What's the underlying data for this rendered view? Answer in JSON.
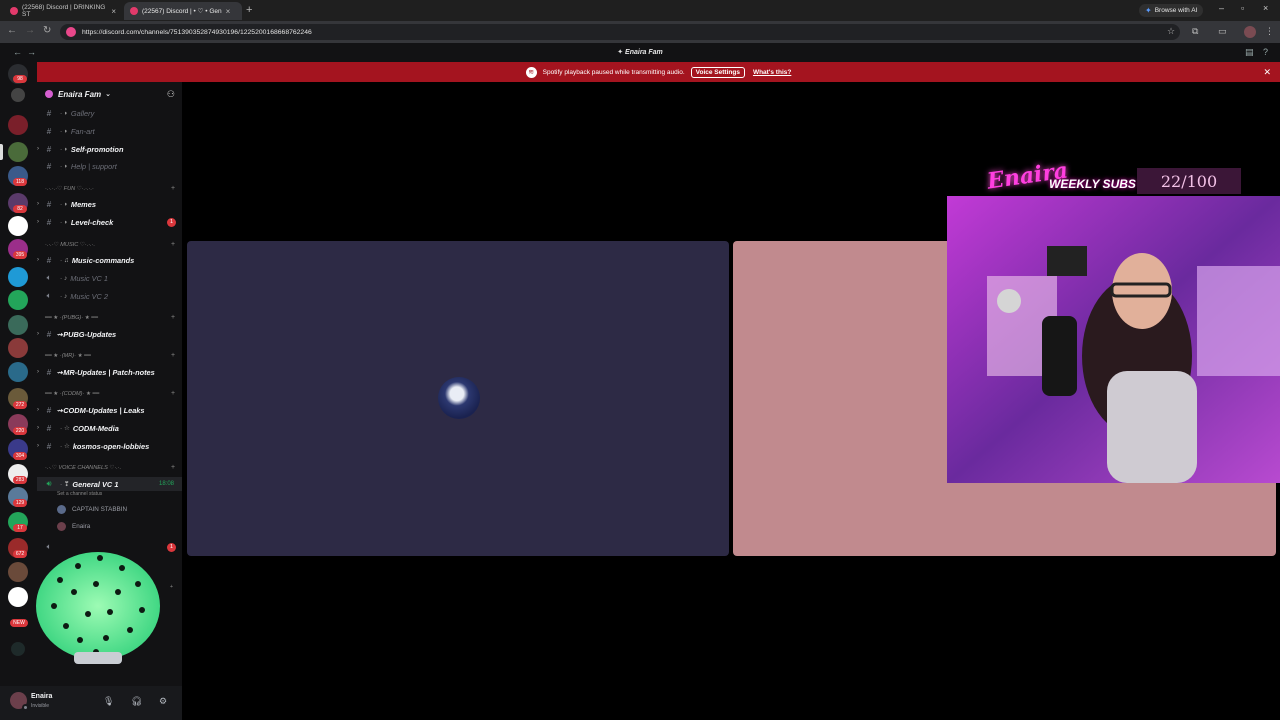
{
  "browser": {
    "tabs": [
      {
        "title": "(22568) Discord | DRINKING ST"
      },
      {
        "title": "(22567) Discord | • ♡ • Gen"
      }
    ],
    "new_tab": "+",
    "browse_ai": "Browse with AI",
    "url": "https://discord.com/channels/751390352874930196/1225200168668762246"
  },
  "discord": {
    "window_title": "Enaira Fam",
    "notice": {
      "message": "Spotify playback paused while transmitting audio.",
      "voice_settings": "Voice Settings",
      "whats_this": "What's this?"
    },
    "rail_badges": [
      "98",
      "118",
      "82",
      "395",
      "272",
      "220",
      "304",
      "283",
      "129",
      "17",
      "672",
      "NEW"
    ],
    "server": {
      "name": "Enaira Fam"
    },
    "channels": [
      {
        "label": "Gallery"
      },
      {
        "label": "Fan-art"
      },
      {
        "label": "Self-promotion"
      },
      {
        "label": "Help | support"
      },
      {
        "label": "Memes"
      },
      {
        "label": "Level-check",
        "unread": "1"
      },
      {
        "label": "Music-commands"
      },
      {
        "label": "Music VC 1"
      },
      {
        "label": "Music VC 2"
      },
      {
        "label": "⇝PUBG-Updates"
      },
      {
        "label": "⇝MR-Updates | Patch-notes"
      },
      {
        "label": "⇝CODM-Updates | Leaks"
      },
      {
        "label": "CODM-Media"
      },
      {
        "label": "kosmos-open-lobbies"
      },
      {
        "label": "General VC 1",
        "timer": "18:08"
      }
    ],
    "categories": [
      {
        "label": "·.·.·.·♡ FUN ♡·.·.·.·"
      },
      {
        "label": "·.·.·♡ MUSIC ♡·.·.·."
      },
      {
        "label": "━━ ★ ·(PUBG)· ★ ━━"
      },
      {
        "label": "━━ ★ ·(MR)· ★ ━━"
      },
      {
        "label": "━━ ★ ·(CODM)· ★ ━━"
      },
      {
        "label": "·.·.♡ VOICE CHANNELS ♡·.·."
      }
    ],
    "set_status": "Set a channel status",
    "voice_users": [
      {
        "name": "CAPTAIN STABBIN"
      },
      {
        "name": "Enaira"
      }
    ],
    "extra_unread": "1",
    "user": {
      "name": "Enaira",
      "status": "Invisible"
    }
  },
  "stream_overlay": {
    "brand": "Enaira",
    "label": "WEEKLY SUBS ♥",
    "count": "22/100"
  },
  "colors": {
    "notice_bg": "#a4141f",
    "tile1": "#2d2a45",
    "tile2": "#c18a8e",
    "online": "#23a55a"
  }
}
